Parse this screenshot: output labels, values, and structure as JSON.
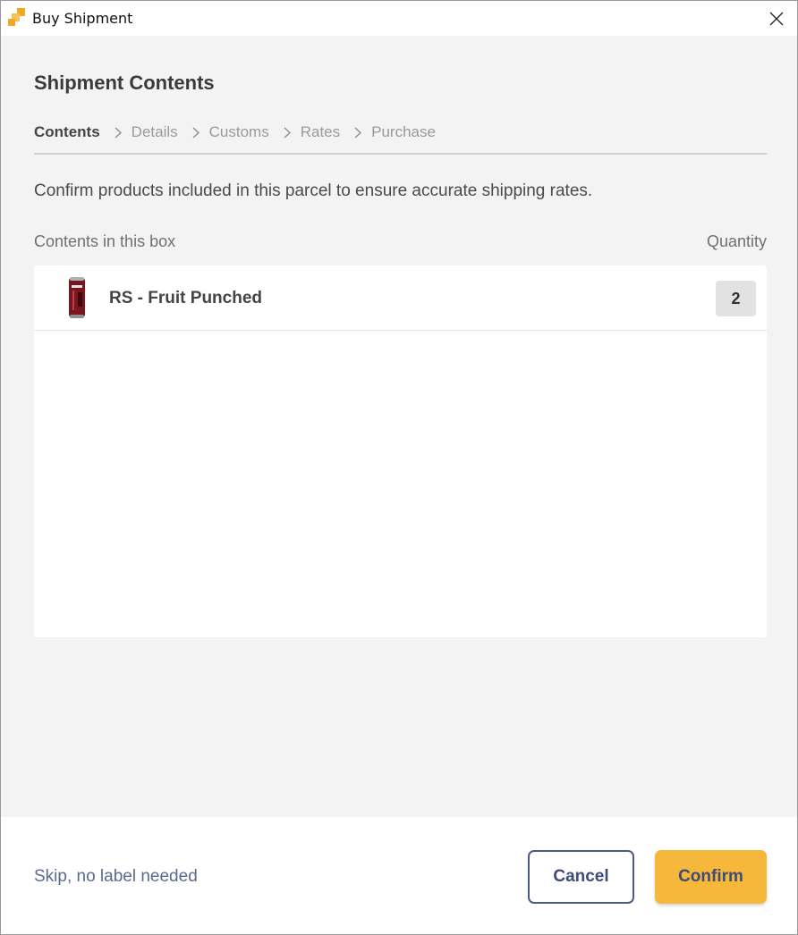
{
  "window": {
    "title": "Buy Shipment",
    "icon": "app-logo-icon",
    "close_icon": "close-icon"
  },
  "page": {
    "heading": "Shipment Contents",
    "steps": [
      {
        "label": "Contents",
        "active": true
      },
      {
        "label": "Details",
        "active": false
      },
      {
        "label": "Customs",
        "active": false
      },
      {
        "label": "Rates",
        "active": false
      },
      {
        "label": "Purchase",
        "active": false
      }
    ],
    "description": "Confirm products included in this parcel to ensure accurate shipping rates.",
    "contents_label": "Contents in this box",
    "quantity_label": "Quantity",
    "items": [
      {
        "name": "RS - Fruit Punched",
        "quantity": "2",
        "thumbnail": "can-product-icon"
      }
    ]
  },
  "footer": {
    "skip_label": "Skip, no label needed",
    "cancel_label": "Cancel",
    "confirm_label": "Confirm"
  },
  "colors": {
    "accent": "#f5b83a",
    "button_text": "#3f4c78",
    "link": "#5a6b8f",
    "background": "#f3f3f3"
  }
}
